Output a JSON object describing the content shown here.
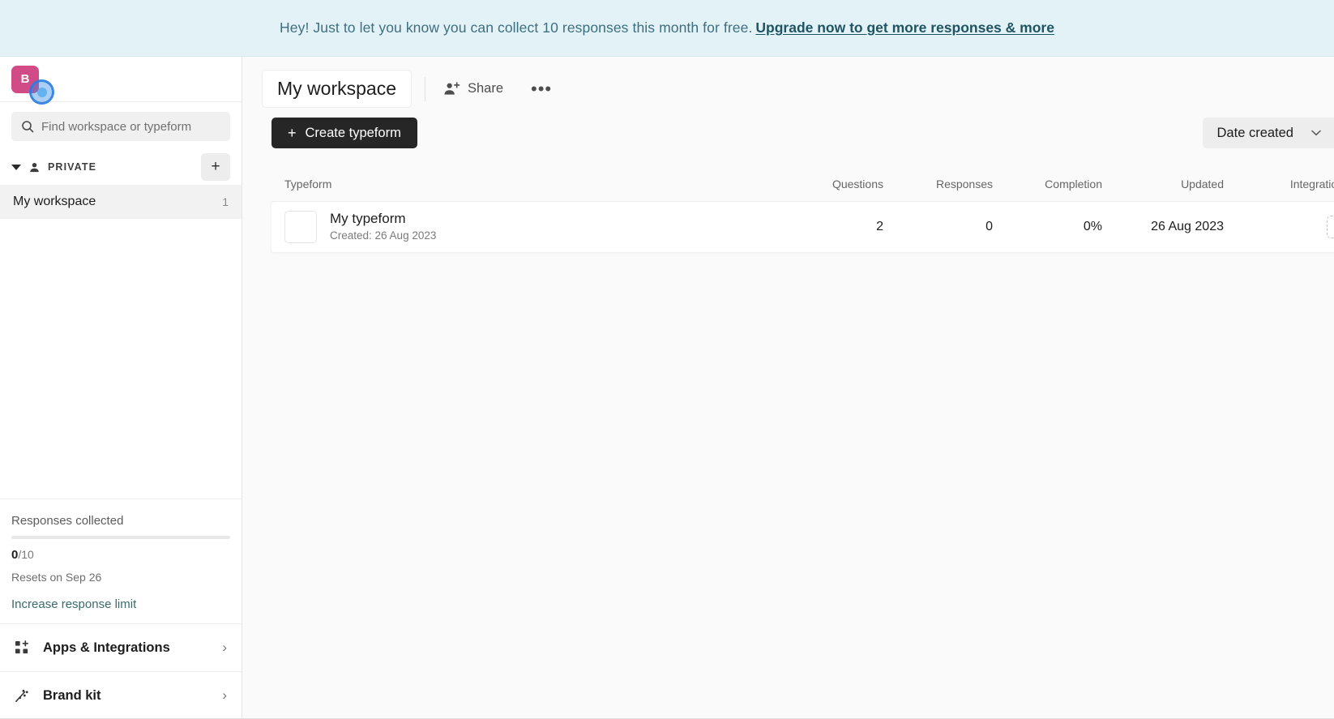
{
  "banner": {
    "message": "Hey! Just to let you know you can collect 10 responses this month for free.",
    "link_text": "Upgrade now to get more responses & more",
    "background": "#e3f2f7",
    "link_color": "#1f5462"
  },
  "sidebar": {
    "avatar": {
      "initial": "B",
      "color": "#d14b86"
    },
    "search": {
      "placeholder": "Find workspace or typeform",
      "value": "",
      "icon": "search-icon"
    },
    "section": {
      "label": "PRIVATE",
      "collapse_icon": "caret-down-icon",
      "person_icon": "person-icon",
      "add_label": "+"
    },
    "workspaces": [
      {
        "label": "My workspace",
        "count": "1",
        "selected": true
      }
    ],
    "responses": {
      "title": "Responses collected",
      "used": "0",
      "separator": "/",
      "limit": "10",
      "reset_text": "Resets on Sep 26",
      "upgrade_link": "Increase response limit",
      "progress_percent": 0
    },
    "nav_links": [
      {
        "label": "Apps & Integrations",
        "icon": "apps-grid-icon",
        "chevron": "›"
      },
      {
        "label": "Brand kit",
        "icon": "brand-kit-icon",
        "chevron": "›"
      }
    ]
  },
  "main": {
    "workspace_title": "My workspace",
    "share_label": "Share",
    "share_icon": "person-add-icon",
    "more_label": "•••",
    "create_button": {
      "label": "Create typeform",
      "plus": "+"
    },
    "sort": {
      "value": "Date created",
      "chevron": "⌄"
    },
    "table": {
      "columns": [
        "Typeform",
        "Questions",
        "Responses",
        "Completion",
        "Updated",
        "Integrations"
      ],
      "rows": [
        {
          "name": "My typeform",
          "created": "Created: 26 Aug 2023",
          "questions": "2",
          "responses": "0",
          "completion": "0%",
          "updated": "26 Aug 2023",
          "integration_add": "+"
        }
      ]
    }
  }
}
